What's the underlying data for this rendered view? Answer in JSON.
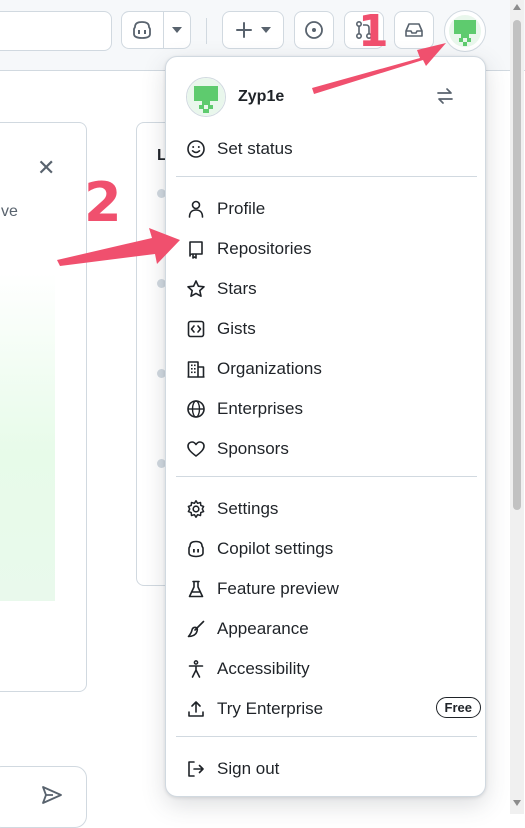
{
  "menu": {
    "username": "Zyp1e",
    "sections": [
      [
        {
          "label": "Set status",
          "icon": "smiley-icon",
          "name": "menu-item-set-status"
        }
      ],
      [
        {
          "label": "Profile",
          "icon": "person-icon",
          "name": "menu-item-profile"
        },
        {
          "label": "Repositories",
          "icon": "repo-icon",
          "name": "menu-item-repositories"
        },
        {
          "label": "Stars",
          "icon": "star-icon",
          "name": "menu-item-stars"
        },
        {
          "label": "Gists",
          "icon": "code-square-icon",
          "name": "menu-item-gists"
        },
        {
          "label": "Organizations",
          "icon": "organization-icon",
          "name": "menu-item-organizations"
        },
        {
          "label": "Enterprises",
          "icon": "globe-icon",
          "name": "menu-item-enterprises"
        },
        {
          "label": "Sponsors",
          "icon": "heart-icon",
          "name": "menu-item-sponsors"
        }
      ],
      [
        {
          "label": "Settings",
          "icon": "gear-icon",
          "name": "menu-item-settings"
        },
        {
          "label": "Copilot settings",
          "icon": "copilot-icon",
          "name": "menu-item-copilot-settings"
        },
        {
          "label": "Feature preview",
          "icon": "beaker-icon",
          "name": "menu-item-feature-preview"
        },
        {
          "label": "Appearance",
          "icon": "paintbrush-icon",
          "name": "menu-item-appearance"
        },
        {
          "label": "Accessibility",
          "icon": "accessibility-icon",
          "name": "menu-item-accessibility"
        },
        {
          "label": "Try Enterprise",
          "icon": "upload-icon",
          "name": "menu-item-try-enterprise",
          "badge": "Free"
        }
      ],
      [
        {
          "label": "Sign out",
          "icon": "sign-out-icon",
          "name": "menu-item-sign-out"
        }
      ]
    ]
  },
  "background": {
    "left_card_fragment": "ve",
    "mid_card_fragment": "L"
  },
  "annotations": {
    "step1": "1",
    "step2": "2",
    "color": "#f0506e"
  },
  "colors": {
    "avatar_green": "#5ecb6e",
    "border": "#d1d9e0",
    "text": "#1f2328"
  }
}
